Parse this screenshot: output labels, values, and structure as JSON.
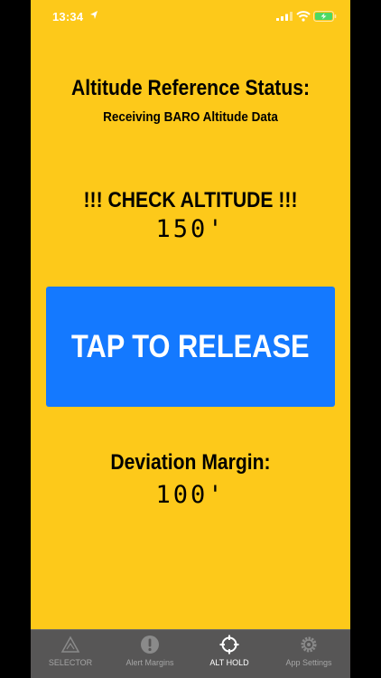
{
  "status_bar": {
    "time": "13:34"
  },
  "main": {
    "title": "Altitude Reference Status:",
    "subtitle": "Receiving BARO Altitude Data",
    "warning": "!!! CHECK ALTITUDE !!!",
    "altitude_value": "150'",
    "release_button_label": "TAP TO RELEASE",
    "deviation_label": "Deviation Margin:",
    "deviation_value": "100'"
  },
  "colors": {
    "background": "#FDC91A",
    "button": "#1479FF",
    "tab_bar": "#575656"
  },
  "tabs": [
    {
      "label": "SELECTOR",
      "icon": "alert-triangle-icon",
      "active": false
    },
    {
      "label": "Alert Margins",
      "icon": "exclamation-circle-icon",
      "active": false
    },
    {
      "label": "ALT HOLD",
      "icon": "crosshair-icon",
      "active": true
    },
    {
      "label": "App Settings",
      "icon": "gear-icon",
      "active": false
    }
  ]
}
